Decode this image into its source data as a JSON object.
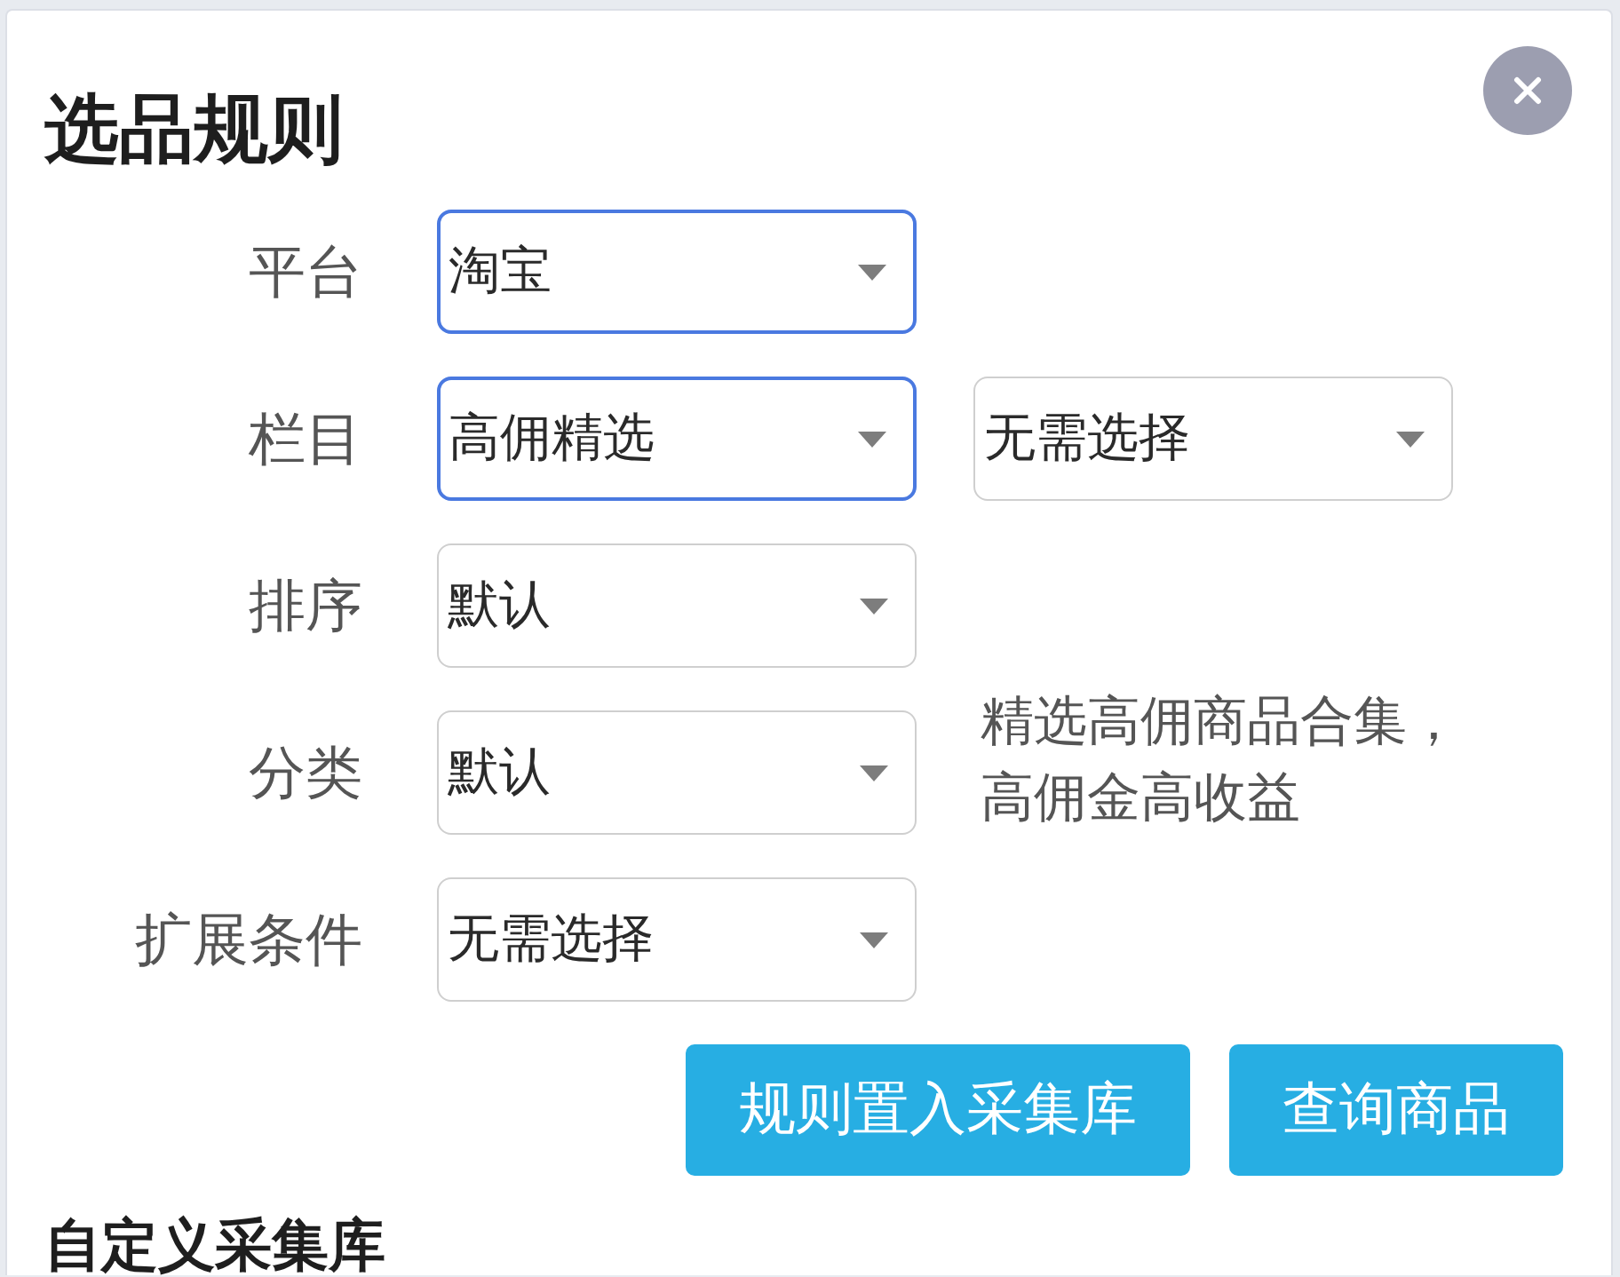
{
  "title": "选品规则",
  "fields": [
    {
      "label": "平台",
      "selects": [
        {
          "value": "淘宝",
          "highlighted": true
        }
      ]
    },
    {
      "label": "栏目",
      "selects": [
        {
          "value": "高佣精选",
          "highlighted": true
        },
        {
          "value": "无需选择",
          "highlighted": false
        }
      ]
    },
    {
      "label": "排序",
      "selects": [
        {
          "value": "默认",
          "highlighted": false
        }
      ]
    },
    {
      "label": "分类",
      "selects": [
        {
          "value": "默认",
          "highlighted": false
        }
      ]
    },
    {
      "label": "扩展条件",
      "selects": [
        {
          "value": "无需选择",
          "highlighted": false
        }
      ]
    }
  ],
  "description": "精选高佣商品合集，高佣金高收益",
  "buttons": [
    "规则置入采集库",
    "查询商品"
  ],
  "next_section": {
    "title": "自定义采集库"
  }
}
